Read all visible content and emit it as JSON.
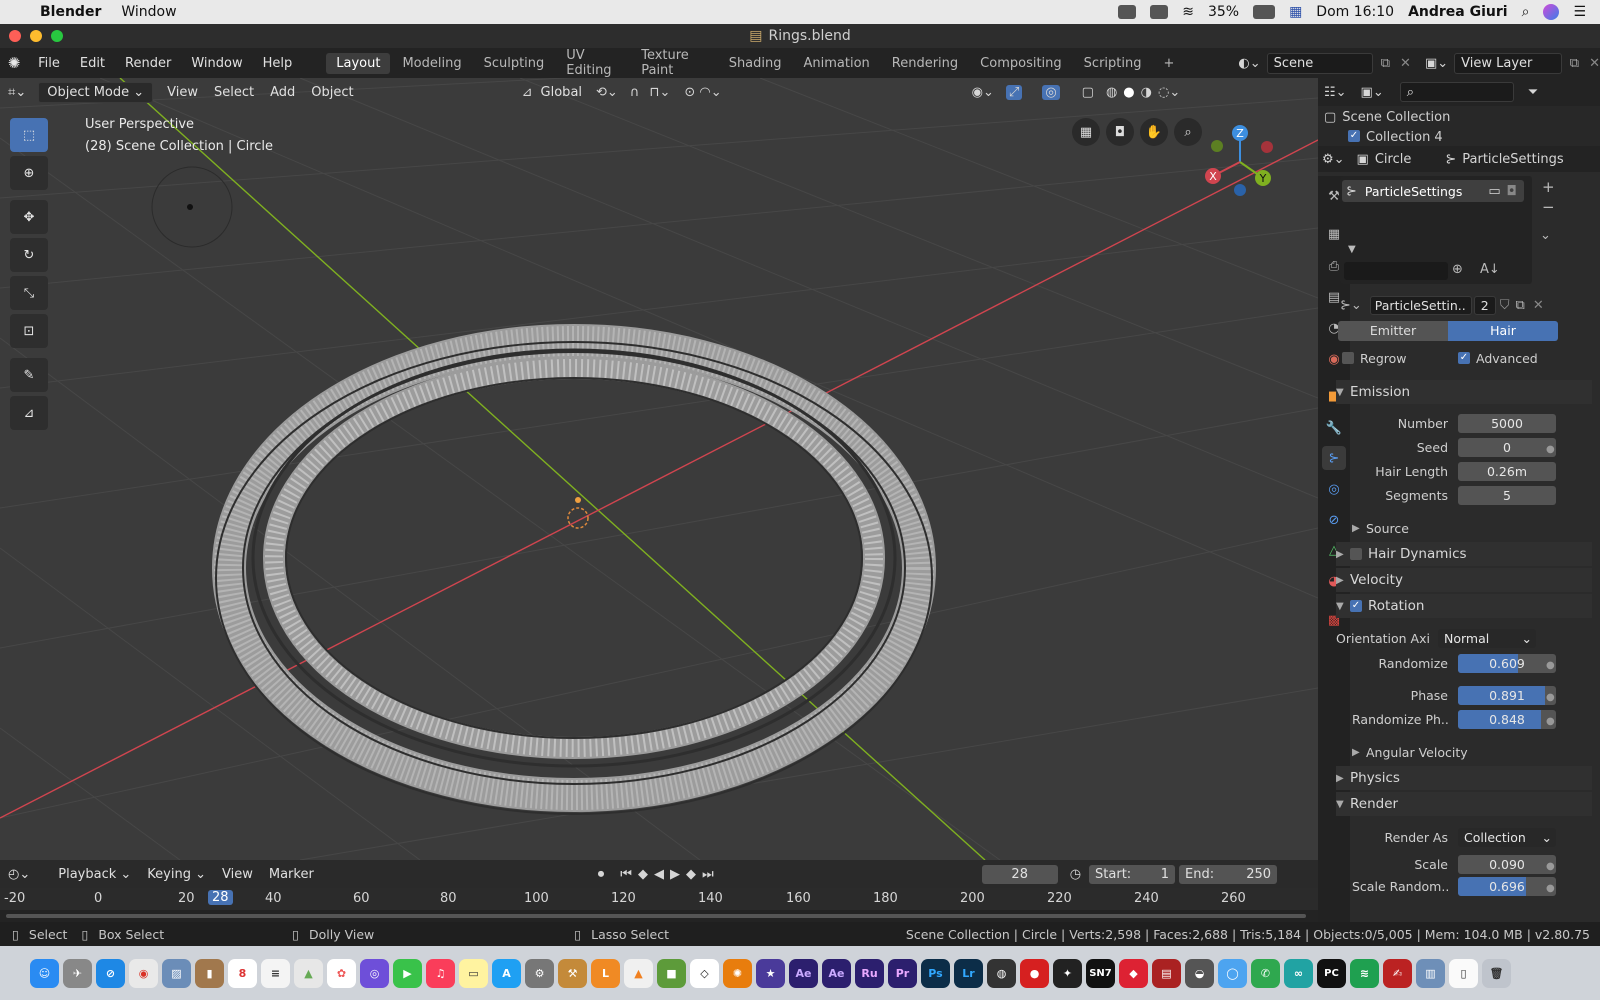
{
  "mac_menubar": {
    "app": "Blender",
    "menu": "Window",
    "battery": "35%",
    "datetime": "Dom 16:10",
    "user": "Andrea Giuri"
  },
  "window": {
    "title": "Rings.blend"
  },
  "topbar": {
    "menus": [
      "File",
      "Edit",
      "Render",
      "Window",
      "Help"
    ],
    "workspaces": [
      "Layout",
      "Modeling",
      "Sculpting",
      "UV Editing",
      "Texture Paint",
      "Shading",
      "Animation",
      "Rendering",
      "Compositing",
      "Scripting"
    ],
    "active_workspace": "Layout",
    "add_tab": "+",
    "scene": "Scene",
    "view_layer": "View Layer"
  },
  "viewport": {
    "mode": "Object Mode",
    "menus": [
      "View",
      "Select",
      "Add",
      "Object"
    ],
    "transform_orientation": "Global",
    "overlay_line1": "User Perspective",
    "overlay_line2": "(28) Scene Collection | Circle",
    "gizmo": {
      "x": "X",
      "y": "Y",
      "z": "Z"
    }
  },
  "outliner": {
    "root": "Scene Collection",
    "child": "Collection 4"
  },
  "properties": {
    "object": "Circle",
    "data": "ParticleSettings",
    "list_item": "ParticleSettings",
    "settings_name": "ParticleSettin..",
    "users": "2",
    "type_tabs": [
      "Emitter",
      "Hair"
    ],
    "active_type": "Hair",
    "regrow": "Regrow",
    "advanced": "Advanced",
    "emission": {
      "title": "Emission",
      "number_label": "Number",
      "number": "5000",
      "seed_label": "Seed",
      "seed": "0",
      "hair_length_label": "Hair Length",
      "hair_length": "0.26m",
      "segments_label": "Segments",
      "segments": "5",
      "source": "Source"
    },
    "hair_dynamics": "Hair Dynamics",
    "velocity": "Velocity",
    "rotation": {
      "title": "Rotation",
      "orientation_label": "Orientation Axi",
      "orientation": "Normal",
      "randomize_label": "Randomize",
      "randomize": "0.609",
      "phase_label": "Phase",
      "phase": "0.891",
      "randomize_phase_label": "Randomize Ph..",
      "randomize_phase": "0.848",
      "angular_velocity": "Angular Velocity"
    },
    "physics": "Physics",
    "render": {
      "title": "Render",
      "render_as_label": "Render As",
      "render_as": "Collection",
      "scale_label": "Scale",
      "scale": "0.090",
      "scale_random_label": "Scale Random..",
      "scale_random": "0.696"
    }
  },
  "timeline": {
    "menus": [
      "Playback",
      "Keying",
      "View",
      "Marker"
    ],
    "current_frame": "28",
    "start_label": "Start:",
    "start": "1",
    "end_label": "End:",
    "end": "250",
    "ruler": [
      "-20",
      "0",
      "20",
      "28",
      "40",
      "60",
      "80",
      "100",
      "120",
      "140",
      "160",
      "180",
      "200",
      "220",
      "240",
      "260"
    ]
  },
  "statusbar": {
    "select": "Select",
    "box_select": "Box Select",
    "dolly": "Dolly View",
    "lasso": "Lasso Select",
    "info": "Scene Collection | Circle | Verts:2,598 | Faces:2,688 | Tris:5,184 | Objects:0/5,005 | Mem: 104.0 MB | v2.80.75"
  },
  "dock": {
    "labels": [
      "Ae",
      "Ae",
      "Ru",
      "Pr",
      "Ps",
      "Lr",
      "SN7",
      "PC",
      "8"
    ]
  },
  "colors": {
    "accent": "#4772b3",
    "x_axis": "#d0454f",
    "y_axis": "#7fb020",
    "z_axis": "#3d8fe0"
  }
}
